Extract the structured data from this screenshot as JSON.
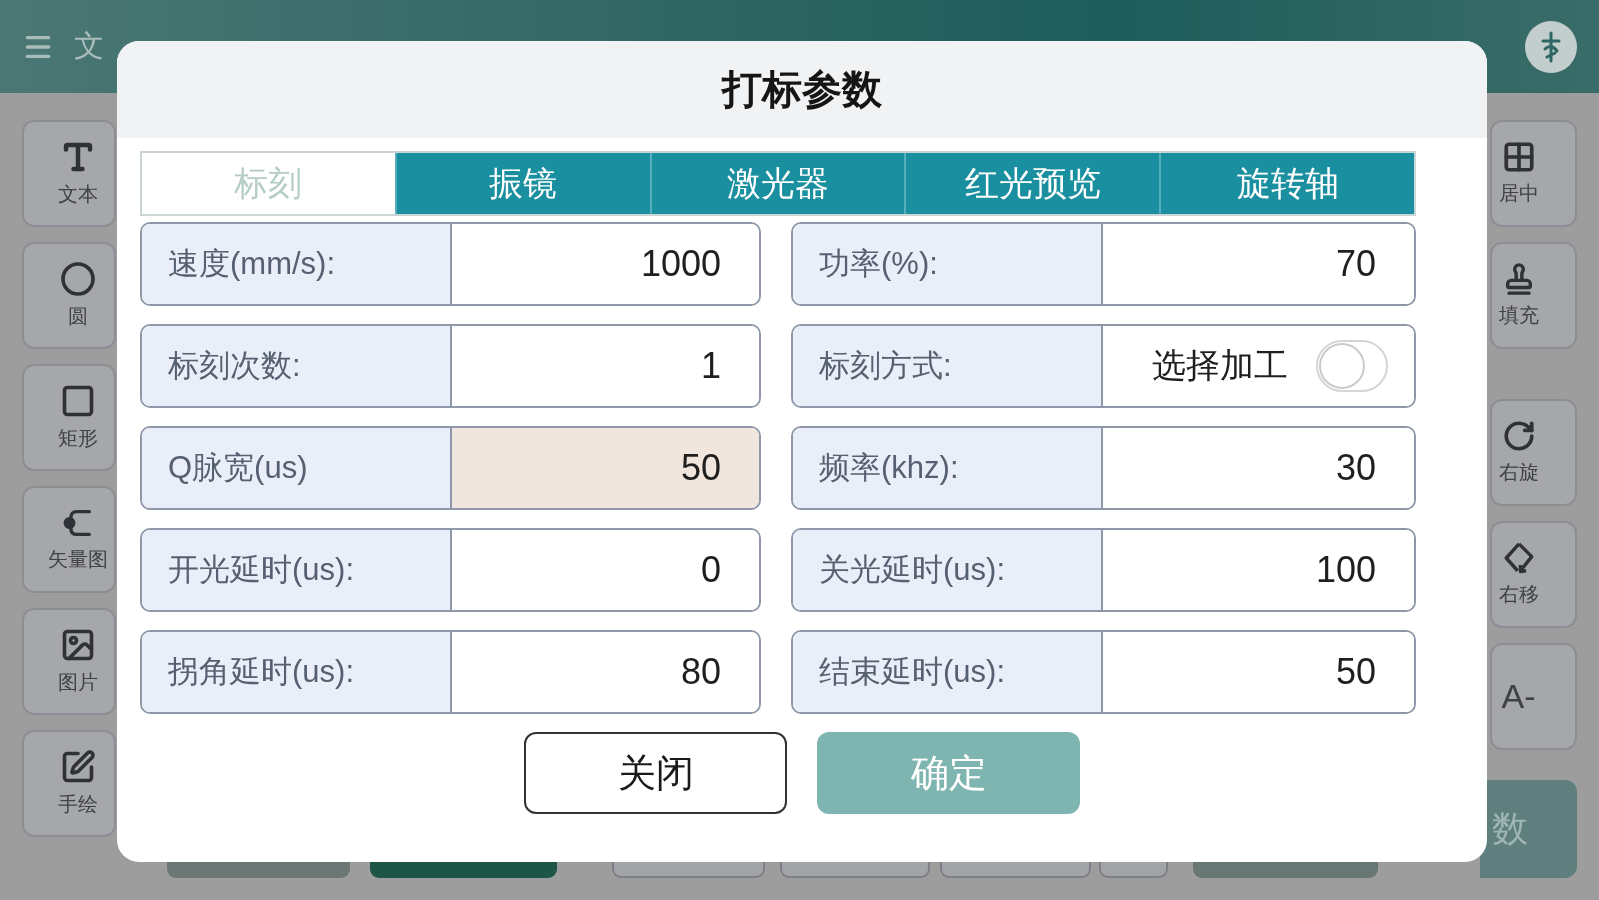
{
  "top_bar": {
    "menu_label": "文"
  },
  "left_toolbar": [
    {
      "label": "文本",
      "kind": "text"
    },
    {
      "label": "圆",
      "kind": "circle"
    },
    {
      "label": "矩形",
      "kind": "rectangle"
    },
    {
      "label": "矢量图",
      "kind": "vector"
    },
    {
      "label": "图片",
      "kind": "image"
    },
    {
      "label": "手绘",
      "kind": "draw"
    }
  ],
  "right_toolbar": [
    {
      "label": "居中",
      "kind": "center"
    },
    {
      "label": "填充",
      "kind": "fill"
    },
    {
      "label": "右旋",
      "kind": "rotate"
    },
    {
      "label": "右移",
      "kind": "move"
    },
    {
      "label": "A-",
      "kind": "text_only"
    }
  ],
  "parameters_button": {
    "label": "数"
  },
  "dialog": {
    "title": "打标参数",
    "tabs": [
      {
        "label": "标刻",
        "selected": true
      },
      {
        "label": "振镜",
        "selected": false
      },
      {
        "label": "激光器",
        "selected": false
      },
      {
        "label": "红光预览",
        "selected": false
      },
      {
        "label": "旋转轴",
        "selected": false
      }
    ],
    "fields": [
      {
        "label": "速度(mm/s):",
        "kind": "input",
        "value": "1000",
        "highlighted": false
      },
      {
        "label": "功率(%):",
        "kind": "input",
        "value": "70",
        "highlighted": false
      },
      {
        "label": "标刻次数:",
        "kind": "input",
        "value": "1",
        "highlighted": false
      },
      {
        "label": "标刻方式:",
        "kind": "toggle",
        "value": "选择加工",
        "on": false,
        "highlighted": false
      },
      {
        "label": "Q脉宽(us)",
        "kind": "input",
        "value": "50",
        "highlighted": true
      },
      {
        "label": "频率(khz):",
        "kind": "input",
        "value": "30",
        "highlighted": false
      },
      {
        "label": "开光延时(us):",
        "kind": "input",
        "value": "0",
        "highlighted": false
      },
      {
        "label": "关光延时(us):",
        "kind": "input",
        "value": "100",
        "highlighted": false
      },
      {
        "label": "拐角延时(us):",
        "kind": "input",
        "value": "80",
        "highlighted": false
      },
      {
        "label": "结束延时(us):",
        "kind": "input",
        "value": "50",
        "highlighted": false
      }
    ],
    "buttons": [
      {
        "label": "关闭",
        "kind": "secondary"
      },
      {
        "label": "确定",
        "kind": "primary"
      }
    ]
  }
}
